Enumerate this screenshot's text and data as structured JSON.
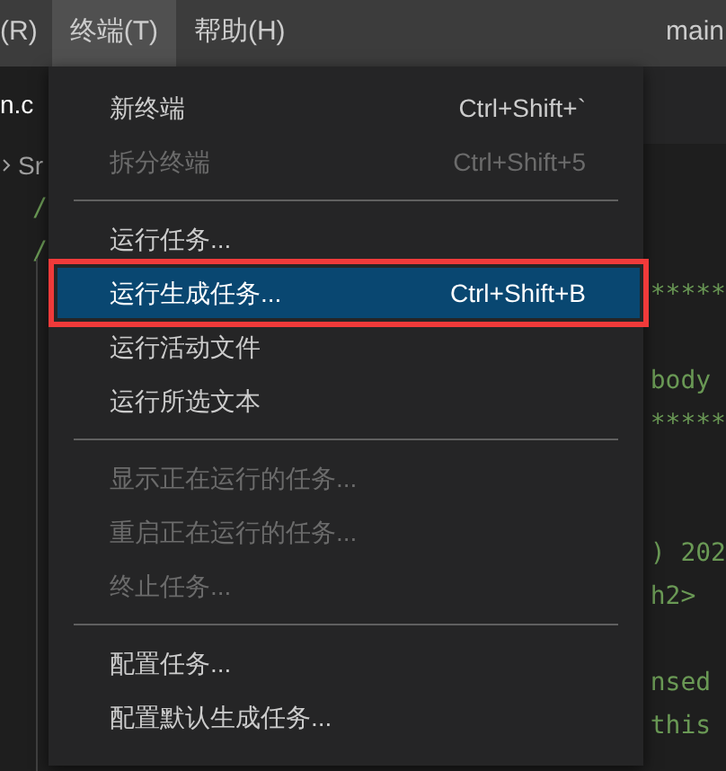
{
  "menubar": [
    {
      "label": "(R)",
      "selected": false
    },
    {
      "label": "终端(T)",
      "selected": true
    },
    {
      "label": "帮助(H)",
      "selected": false
    }
  ],
  "title": "main",
  "tab": {
    "label": "n.c"
  },
  "breadcrumb": "Sr",
  "code_left": [
    "/",
    "/"
  ],
  "code_right_blocks": [
    [
      "*****"
    ],
    [
      "body",
      "*****"
    ],
    [
      ") 202",
      "h2>"
    ],
    [
      "nsed",
      "this"
    ]
  ],
  "menu": [
    {
      "kind": "item",
      "label": "新终端",
      "shortcut": "Ctrl+Shift+`",
      "disabled": false,
      "selected": false,
      "outlined": false
    },
    {
      "kind": "item",
      "label": "拆分终端",
      "shortcut": "Ctrl+Shift+5",
      "disabled": true,
      "selected": false,
      "outlined": false
    },
    {
      "kind": "separator"
    },
    {
      "kind": "item",
      "label": "运行任务...",
      "disabled": false,
      "selected": false,
      "outlined": false
    },
    {
      "kind": "item",
      "label": "运行生成任务...",
      "shortcut": "Ctrl+Shift+B",
      "disabled": false,
      "selected": true,
      "outlined": true
    },
    {
      "kind": "item",
      "label": "运行活动文件",
      "disabled": false,
      "selected": false,
      "outlined": false
    },
    {
      "kind": "item",
      "label": "运行所选文本",
      "disabled": false,
      "selected": false,
      "outlined": false
    },
    {
      "kind": "separator"
    },
    {
      "kind": "item",
      "label": "显示正在运行的任务...",
      "disabled": true,
      "selected": false,
      "outlined": false
    },
    {
      "kind": "item",
      "label": "重启正在运行的任务...",
      "disabled": true,
      "selected": false,
      "outlined": false
    },
    {
      "kind": "item",
      "label": "终止任务...",
      "disabled": true,
      "selected": false,
      "outlined": false
    },
    {
      "kind": "separator"
    },
    {
      "kind": "item",
      "label": "配置任务...",
      "disabled": false,
      "selected": false,
      "outlined": false
    },
    {
      "kind": "item",
      "label": "配置默认生成任务...",
      "disabled": false,
      "selected": false,
      "outlined": false
    }
  ]
}
